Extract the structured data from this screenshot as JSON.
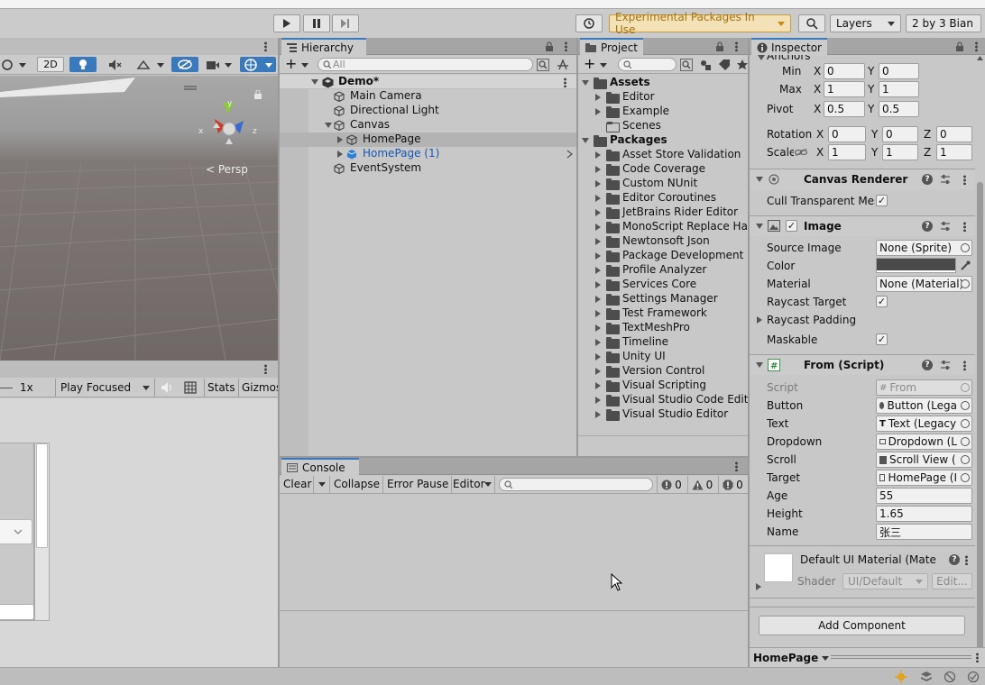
{
  "toolbar": {
    "experimental": "Experimental Packages In Use",
    "layers": "Layers",
    "layout": "2 by 3 Bian"
  },
  "scene": {
    "mode_2d": "2D",
    "persp": "Persp",
    "axis_x": "x",
    "axis_y": "y",
    "axis_z": "z"
  },
  "game": {
    "scale": "1x",
    "play_mode": "Play Focused",
    "stats": "Stats",
    "gizmos": "Gizmos"
  },
  "hierarchy": {
    "tab": "Hierarchy",
    "search_placeholder": "All",
    "scene": "Demo*",
    "items": [
      {
        "label": "Main Camera"
      },
      {
        "label": "Directional Light"
      },
      {
        "label": "Canvas"
      },
      {
        "label": "HomePage"
      },
      {
        "label": "HomePage (1)"
      },
      {
        "label": "EventSystem"
      }
    ]
  },
  "project": {
    "tab": "Project",
    "assets": "Assets",
    "asset_folders": [
      "Editor",
      "Example",
      "Scenes"
    ],
    "packages": "Packages",
    "package_folders": [
      "Asset Store Validation",
      "Code Coverage",
      "Custom NUnit",
      "Editor Coroutines",
      "JetBrains Rider Editor",
      "MonoScript Replace Han",
      "Newtonsoft Json",
      "Package Development",
      "Profile Analyzer",
      "Services Core",
      "Settings Manager",
      "Test Framework",
      "TextMeshPro",
      "Timeline",
      "Unity UI",
      "Version Control",
      "Visual Scripting",
      "Visual Studio Code Editor",
      "Visual Studio Editor"
    ]
  },
  "console": {
    "tab": "Console",
    "clear": "Clear",
    "collapse": "Collapse",
    "error_pause": "Error Pause",
    "editor": "Editor",
    "log_count": "0",
    "warn_count": "0",
    "error_count": "0"
  },
  "inspector": {
    "tab": "Inspector",
    "anchors": "Anchors",
    "min": "Min",
    "max": "Max",
    "pivot": "Pivot",
    "rotation": "Rotation",
    "scale": "Scale",
    "x": "X",
    "y": "Y",
    "z": "Z",
    "min_x": "0",
    "min_y": "0",
    "max_x": "1",
    "max_y": "1",
    "pivot_x": "0.5",
    "pivot_y": "0.5",
    "rot_x": "0",
    "rot_y": "0",
    "rot_z": "0",
    "scale_x": "1",
    "scale_y": "1",
    "scale_z": "1",
    "canvas_renderer": "Canvas Renderer",
    "cull_transparent": "Cull Transparent Mes",
    "image": "Image",
    "source_image_label": "Source Image",
    "source_image": "None (Sprite)",
    "color_label": "Color",
    "color_value": "#4a4a4a",
    "material_label": "Material",
    "material": "None (Material)",
    "raycast_target": "Raycast Target",
    "raycast_padding": "Raycast Padding",
    "maskable": "Maskable",
    "from_script": "From (Script)",
    "script_label": "Script",
    "script_value": "From",
    "button_label": "Button",
    "button_value": "Button (Lega",
    "text_label": "Text",
    "text_value": "Text (Legacy",
    "dropdown_label": "Dropdown",
    "dropdown_value": "Dropdown (L",
    "scroll_label": "Scroll",
    "scroll_value": "Scroll View (",
    "target_label": "Target",
    "target_value": "HomePage (I",
    "age_label": "Age",
    "age_value": "55",
    "height_label": "Height",
    "height_value": "1.65",
    "name_label": "Name",
    "name_value": "张三",
    "material_name": "Default UI Material (Mate",
    "shader_label": "Shader",
    "shader_value": "UI/Default",
    "edit": "Edit...",
    "add_component": "Add Component",
    "footer_object": "HomePage"
  }
}
